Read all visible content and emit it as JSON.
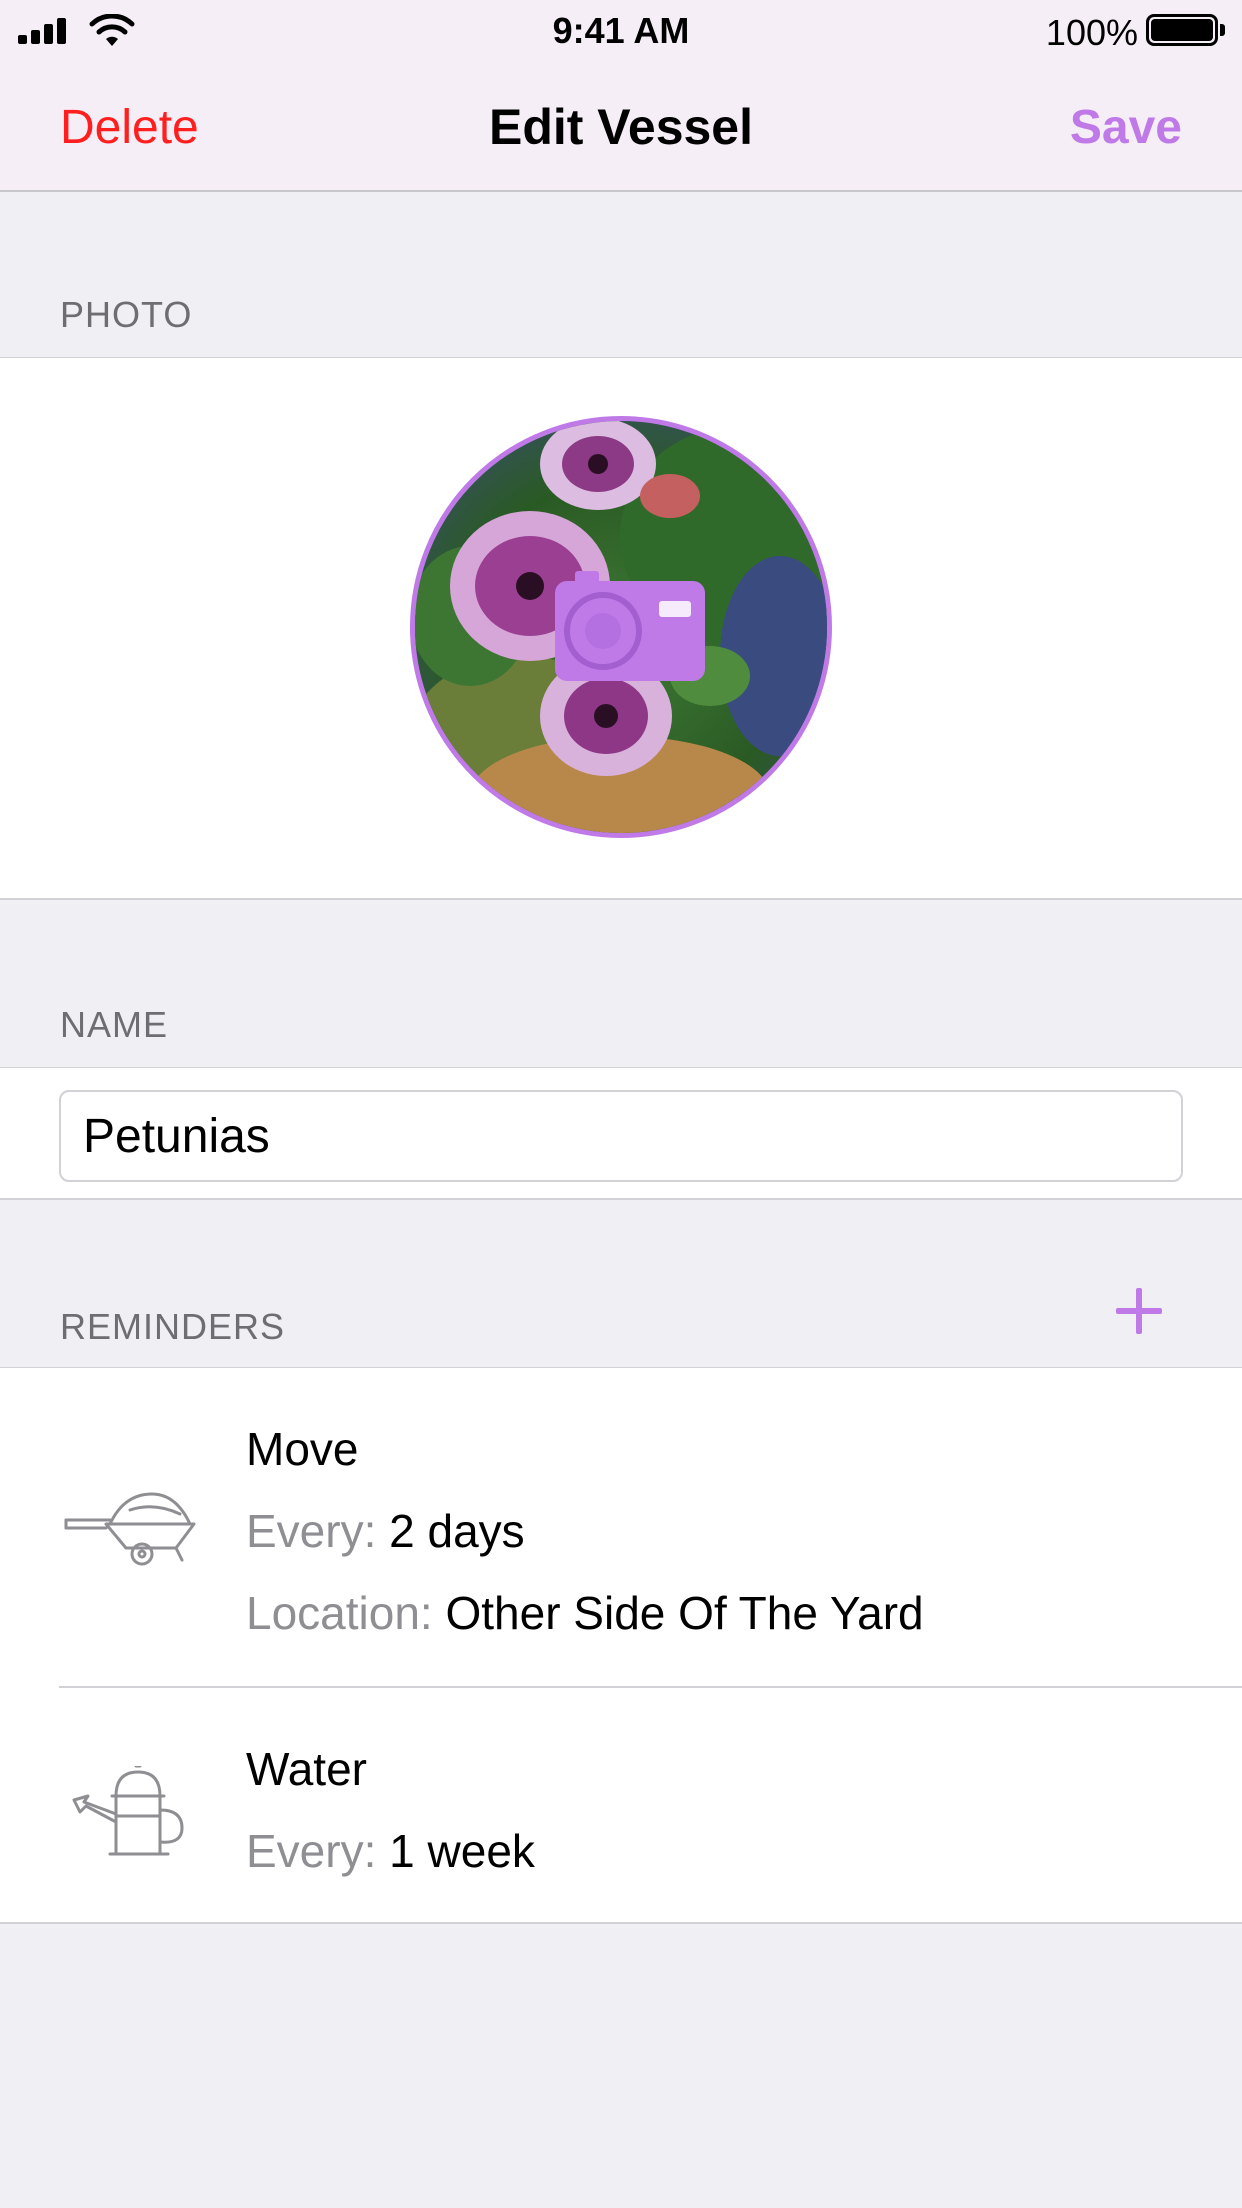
{
  "status_bar": {
    "time": "9:41 AM",
    "battery_percent": "100%",
    "battery_level": 1.0
  },
  "nav": {
    "left_label": "Delete",
    "title": "Edit Vessel",
    "right_label": "Save"
  },
  "photo_section": {
    "header": "PHOTO"
  },
  "name_section": {
    "header": "NAME",
    "value": "Petunias"
  },
  "reminders_section": {
    "header": "REMINDERS",
    "add_icon": "plus-icon",
    "items": [
      {
        "icon": "wheelbarrow-icon",
        "title": "Move",
        "every_label": "Every:",
        "every_value": "2 days",
        "location_label": "Location:",
        "location_value": "Other Side Of The Yard"
      },
      {
        "icon": "watering-can-icon",
        "title": "Water",
        "every_label": "Every:",
        "every_value": "1 week"
      }
    ]
  },
  "colors": {
    "accent": "#c07ae8",
    "destructive": "#ff1f1f",
    "background": "#efeff4",
    "nav_background": "#f6eef7"
  }
}
